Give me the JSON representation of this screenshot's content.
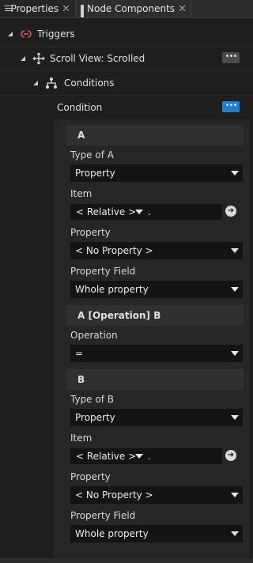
{
  "tabs": [
    {
      "label": "Properties",
      "icon": "list-icon"
    },
    {
      "label": "Node Components",
      "icon": "grid-icon"
    }
  ],
  "close_glyph": "✕",
  "tree": {
    "triggers": "Triggers",
    "scroll_view": "Scroll View: Scrolled",
    "conditions": "Conditions",
    "condition": "Condition",
    "more_glyph": "•••"
  },
  "section_a": {
    "title": "A",
    "type_label": "Type of A",
    "type_value": "Property",
    "item_label": "Item",
    "relative_value": "< Relative >",
    "path_value": ".",
    "property_label": "Property",
    "property_value": "< No Property >",
    "field_label": "Property Field",
    "field_value": "Whole property"
  },
  "section_op": {
    "title": "A [Operation] B",
    "operation_label": "Operation",
    "operation_value": "="
  },
  "section_b": {
    "title": "B",
    "type_label": "Type of B",
    "type_value": "Property",
    "item_label": "Item",
    "relative_value": "< Relative >",
    "path_value": ".",
    "property_label": "Property",
    "property_value": "< No Property >",
    "field_label": "Property Field",
    "field_value": "Whole property"
  },
  "goto_glyph": "➜"
}
